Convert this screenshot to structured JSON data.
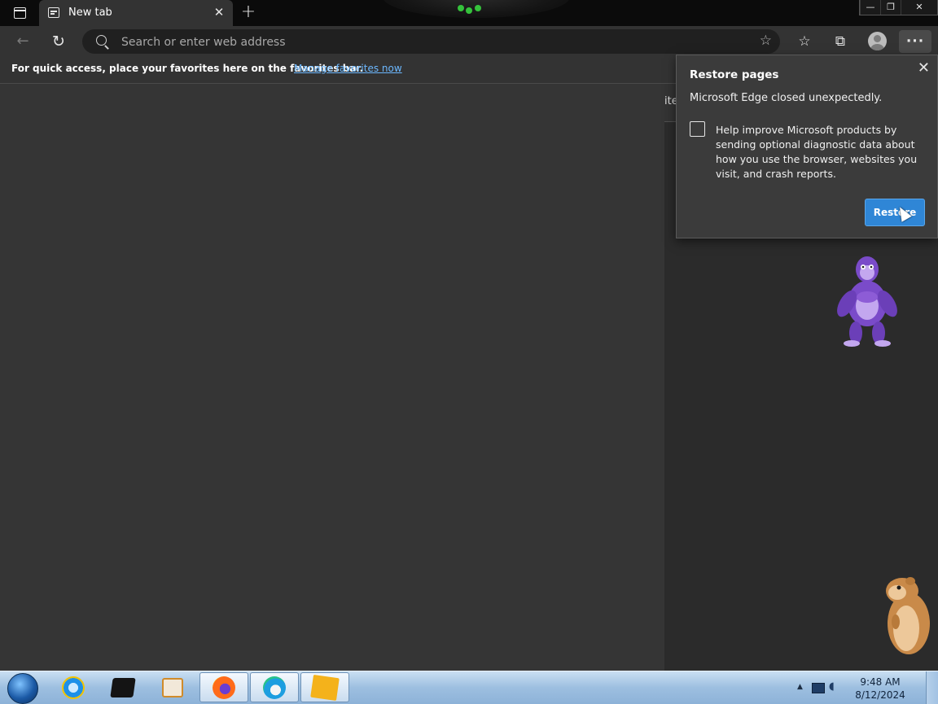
{
  "tabs": [
    {
      "title": "New tab",
      "close_glyph": "✕"
    }
  ],
  "new_tab_glyph": "+",
  "window_controls": {
    "minimize": "—",
    "restore": "❐",
    "close": "✕"
  },
  "nav": {
    "back_glyph": "←",
    "refresh_glyph": "↻",
    "address_placeholder": "Search or enter web address",
    "address_value": ""
  },
  "toolbar": {
    "favorites_glyph": "☆",
    "collections_glyph": "⧉",
    "more_glyph": "···",
    "add_favorite_glyph": "☆"
  },
  "favorites_bar": {
    "message": "For quick access, place your favorites here on the favorites bar.",
    "link": "Manage favorites now"
  },
  "background_peek": "ite",
  "restore_popup": {
    "title": "Restore pages",
    "subtitle": "Microsoft Edge closed unexpectedly.",
    "checkbox_label": "Help improve Microsoft products by sending optional diagnostic data about how you use the browser, websites you visit, and crash reports.",
    "checkbox_checked": false,
    "button": "Restore",
    "close_glyph": "✕"
  },
  "taskbar": {
    "apps": [
      {
        "name": "Internet Explorer",
        "icon": "ie-icon",
        "active": false
      },
      {
        "name": "Command Prompt",
        "icon": "cmd-icon",
        "active": false
      },
      {
        "name": "Windows Media Player",
        "icon": "media-player-icon",
        "active": false
      },
      {
        "name": "Firefox",
        "icon": "firefox-icon",
        "active": true
      },
      {
        "name": "Microsoft Edge",
        "icon": "edge-icon",
        "active": true
      },
      {
        "name": "BonziBuddy",
        "icon": "bonzi-icon",
        "active": true
      }
    ],
    "tray_arrow": "▲",
    "volume_glyph": "◖",
    "time": "9:48 AM",
    "date": "8/12/2024"
  },
  "colors": {
    "titlebar": "#0b0b0b",
    "chrome": "#333333",
    "addressbar": "#202020",
    "link": "#6cb8ff",
    "restore_button": "#2f86d6",
    "popup_bg": "#3b3b3b",
    "bonzi_purple": "#7a4bc9"
  }
}
